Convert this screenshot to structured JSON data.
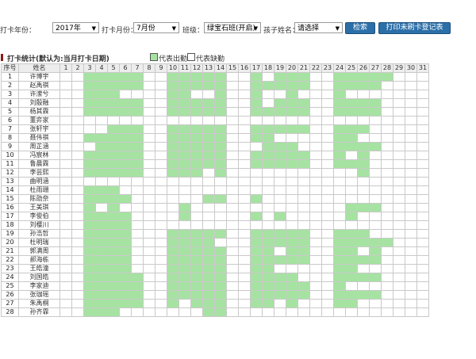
{
  "filters": {
    "year_label": "打卡年份：",
    "year_value": "2017年",
    "month_label": "打卡月份：",
    "month_value": "7月份",
    "class_label": "班级：",
    "class_value": "绿宝石班(开启)",
    "child_label": "孩子姓名：",
    "child_value": "请选择",
    "search_label": "检索",
    "print_label": "打印未刷卡登记表"
  },
  "section": {
    "title": "打卡统计(默认为:当月打卡日期)",
    "legend_present": "代表出勤",
    "legend_absent": "代表缺勤"
  },
  "colors": {
    "present": "#a6e3a2",
    "button": "#2b6fa8"
  },
  "table": {
    "col_no": "序号",
    "col_name": "姓名",
    "days": [
      "1",
      "2",
      "3",
      "4",
      "5",
      "6",
      "7",
      "8",
      "9",
      "10",
      "11",
      "12",
      "13",
      "14",
      "15",
      "16",
      "17",
      "18",
      "19",
      "20",
      "21",
      "22",
      "23",
      "24",
      "25",
      "26",
      "27",
      "28",
      "29",
      "30",
      "31"
    ],
    "rows": [
      {
        "no": "1",
        "name": "许博宇",
        "present": [
          3,
          4,
          5,
          6,
          7,
          10,
          11,
          12,
          13,
          14,
          17,
          19,
          20,
          21,
          24,
          25,
          26,
          27,
          28
        ]
      },
      {
        "no": "2",
        "name": "赵禹祺",
        "present": [
          3,
          4,
          5,
          6,
          7,
          10,
          11,
          12,
          13,
          14,
          17,
          18,
          19,
          20,
          21,
          24,
          25,
          26,
          27
        ]
      },
      {
        "no": "3",
        "name": "许潆兮",
        "present": [
          3,
          4,
          5,
          10,
          11,
          14,
          17,
          20,
          24
        ]
      },
      {
        "no": "4",
        "name": "刘殷融",
        "present": [
          3,
          4,
          5,
          6,
          7,
          10,
          11,
          12,
          13,
          14,
          17,
          19,
          20,
          21,
          24,
          25,
          26,
          27
        ]
      },
      {
        "no": "5",
        "name": "杨其霖",
        "present": [
          3,
          4,
          5,
          6,
          7,
          10,
          11,
          12,
          13,
          14,
          17,
          18,
          19,
          20,
          21,
          24,
          25,
          26,
          27
        ]
      },
      {
        "no": "6",
        "name": "董弈家",
        "present": []
      },
      {
        "no": "7",
        "name": "张轩宇",
        "present": [
          5,
          6,
          7,
          10,
          11,
          12,
          13,
          14,
          17,
          18,
          19,
          20,
          21,
          24,
          25,
          26
        ]
      },
      {
        "no": "8",
        "name": "聂伟祺",
        "present": [
          3,
          4,
          5,
          6,
          7,
          10,
          11,
          12,
          13,
          14,
          17,
          18,
          24,
          25
        ]
      },
      {
        "no": "9",
        "name": "周芷涵",
        "present": [
          4,
          5,
          6,
          7,
          10,
          11,
          12,
          13,
          14,
          18,
          19,
          20,
          24,
          25,
          26,
          27
        ]
      },
      {
        "no": "10",
        "name": "冯宸林",
        "present": [
          3,
          4,
          5,
          6,
          7,
          10,
          11,
          12,
          13,
          14,
          17,
          18,
          19,
          20,
          21,
          24,
          26
        ]
      },
      {
        "no": "11",
        "name": "鲁晨霖",
        "present": [
          3,
          4,
          5,
          6,
          7,
          10,
          11,
          12,
          13,
          14,
          17,
          18,
          19,
          20,
          21,
          24,
          25,
          26
        ]
      },
      {
        "no": "12",
        "name": "李芸熙",
        "present": [
          3,
          4,
          5,
          6,
          7,
          10,
          11,
          12,
          14,
          26
        ]
      },
      {
        "no": "13",
        "name": "曲明涵",
        "present": []
      },
      {
        "no": "14",
        "name": "杜雨珊",
        "present": [
          3,
          4,
          5
        ]
      },
      {
        "no": "15",
        "name": "陈劭奈",
        "present": [
          3,
          4,
          5,
          6,
          13,
          14,
          17
        ]
      },
      {
        "no": "16",
        "name": "王美琪",
        "present": [
          3,
          5,
          11,
          25,
          26,
          27
        ]
      },
      {
        "no": "17",
        "name": "李俊伯",
        "present": [
          3,
          4,
          5,
          6,
          11,
          17,
          19,
          25
        ]
      },
      {
        "no": "18",
        "name": "刘樱川",
        "present": [
          3,
          4,
          5,
          6
        ]
      },
      {
        "no": "19",
        "name": "孙浩哲",
        "present": [
          3,
          4,
          5,
          6,
          10,
          11,
          12,
          13,
          14,
          17,
          18,
          19,
          20,
          21,
          24,
          25,
          26
        ]
      },
      {
        "no": "20",
        "name": "杜明瑞",
        "present": [
          3,
          4,
          5,
          6,
          10,
          11,
          12,
          13,
          17,
          18,
          19,
          20,
          21,
          24,
          25,
          26,
          27,
          28
        ]
      },
      {
        "no": "21",
        "name": "郭满周",
        "present": [
          3,
          4,
          5,
          6,
          10,
          11,
          12,
          13,
          14,
          17,
          18,
          20,
          21,
          24,
          25,
          27
        ]
      },
      {
        "no": "22",
        "name": "郝海栋",
        "present": [
          3,
          4,
          5,
          6,
          10,
          11,
          12,
          13,
          14,
          17,
          18,
          19,
          20,
          21,
          24,
          25,
          26,
          27
        ]
      },
      {
        "no": "23",
        "name": "王皓潼",
        "present": [
          3,
          4,
          5,
          6,
          10,
          11,
          12,
          13,
          14,
          17,
          18,
          24,
          25
        ]
      },
      {
        "no": "24",
        "name": "刘国皓",
        "present": [
          3,
          4,
          5,
          6,
          7,
          10,
          11,
          12,
          13,
          14,
          17,
          18,
          19,
          20,
          24,
          25,
          26,
          27
        ]
      },
      {
        "no": "25",
        "name": "李家迪",
        "present": [
          3,
          4,
          5,
          6,
          7,
          10,
          11,
          12,
          13,
          14,
          17,
          18,
          19,
          20,
          21,
          24
        ]
      },
      {
        "no": "26",
        "name": "张珈瑶",
        "present": [
          3,
          4,
          5,
          6,
          7,
          10,
          11,
          12,
          13,
          14,
          17,
          18,
          19,
          20,
          21,
          24,
          25,
          26,
          27
        ]
      },
      {
        "no": "27",
        "name": "朱禹桐",
        "present": [
          3,
          4,
          5,
          6,
          7,
          10,
          12,
          13,
          14,
          17,
          18,
          20,
          24,
          25
        ]
      },
      {
        "no": "28",
        "name": "孙齐霏",
        "present": [
          3,
          4,
          5,
          13,
          14
        ]
      }
    ]
  }
}
